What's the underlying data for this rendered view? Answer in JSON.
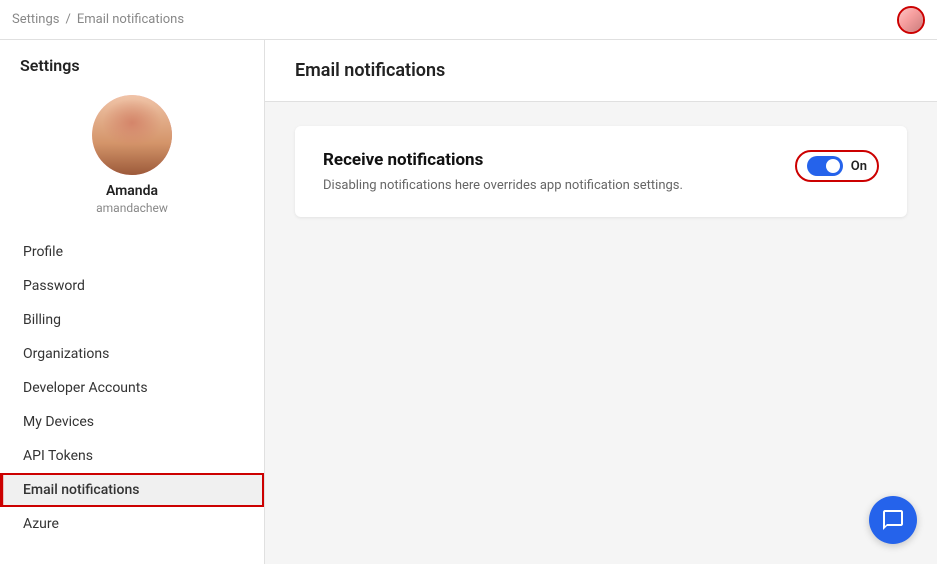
{
  "topbar": {
    "breadcrumb_root": "Settings",
    "breadcrumb_separator": "/",
    "breadcrumb_current": "Email notifications"
  },
  "sidebar": {
    "title": "Settings",
    "user": {
      "name": "Amanda",
      "handle": "amandachew"
    },
    "nav_items": [
      {
        "id": "profile",
        "label": "Profile",
        "active": false
      },
      {
        "id": "password",
        "label": "Password",
        "active": false
      },
      {
        "id": "billing",
        "label": "Billing",
        "active": false
      },
      {
        "id": "organizations",
        "label": "Organizations",
        "active": false
      },
      {
        "id": "developer-accounts",
        "label": "Developer Accounts",
        "active": false
      },
      {
        "id": "my-devices",
        "label": "My Devices",
        "active": false
      },
      {
        "id": "api-tokens",
        "label": "API Tokens",
        "active": false
      },
      {
        "id": "email-notifications",
        "label": "Email notifications",
        "active": true
      },
      {
        "id": "azure",
        "label": "Azure",
        "active": false
      }
    ]
  },
  "main": {
    "page_title": "Email notifications",
    "notification_card": {
      "heading": "Receive notifications",
      "description": "Disabling notifications here overrides app notification settings.",
      "toggle_state": "On",
      "toggle_on": true
    }
  }
}
